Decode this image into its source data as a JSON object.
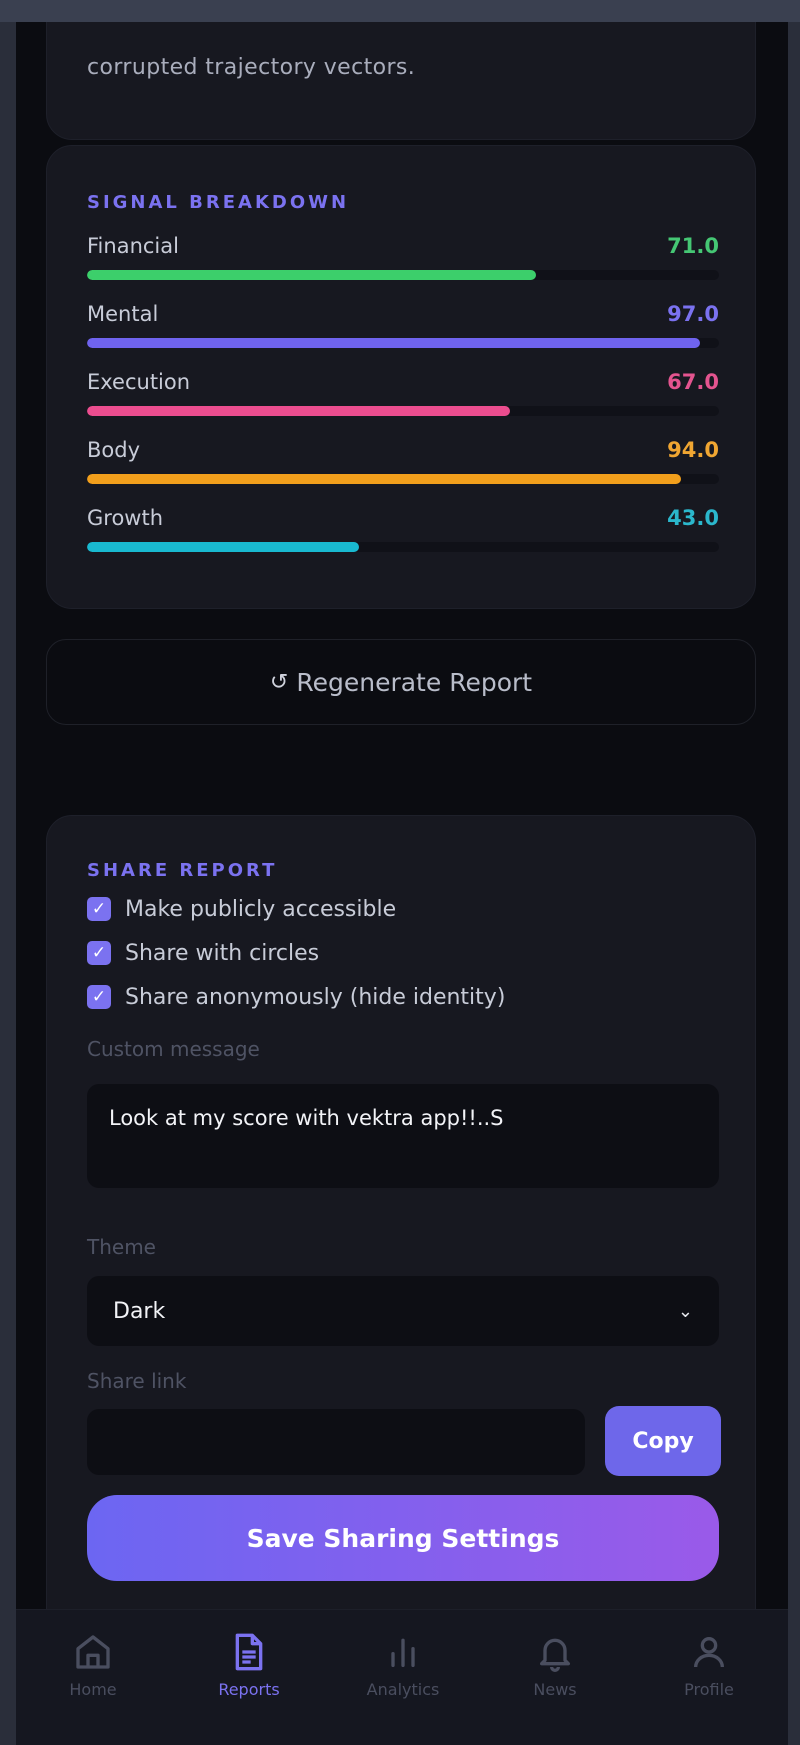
{
  "intro": {
    "text": "corrupted trajectory vectors."
  },
  "signal": {
    "title": "SIGNAL BREAKDOWN",
    "items": [
      {
        "label": "Financial",
        "value": "71.0",
        "fraction": 0.71,
        "color": "#3ccf6b",
        "value_color": "#45c774"
      },
      {
        "label": "Mental",
        "value": "97.0",
        "fraction": 0.97,
        "color": "#6f63ee",
        "value_color": "#7b72f0"
      },
      {
        "label": "Execution",
        "value": "67.0",
        "fraction": 0.67,
        "color": "#ec4d8f",
        "value_color": "#e4548f"
      },
      {
        "label": "Body",
        "value": "94.0",
        "fraction": 0.94,
        "color": "#f29f1c",
        "value_color": "#f0a632"
      },
      {
        "label": "Growth",
        "value": "43.0",
        "fraction": 0.43,
        "color": "#19b9d0",
        "value_color": "#2bb7cc"
      }
    ]
  },
  "regenerate": {
    "icon": "refresh-icon",
    "label": "Regenerate Report"
  },
  "share": {
    "title": "SHARE REPORT",
    "options": [
      {
        "label": "Make publicly accessible",
        "checked": true
      },
      {
        "label": "Share with circles",
        "checked": true
      },
      {
        "label": "Share anonymously (hide identity)",
        "checked": true
      }
    ],
    "custom_message_label": "Custom message",
    "custom_message_value": "Look at my score with vektra app!!..S",
    "theme_label": "Theme",
    "theme_value": "Dark",
    "share_link_label": "Share link",
    "share_link_value": "",
    "copy_label": "Copy",
    "save_label": "Save Sharing Settings"
  },
  "nav": {
    "items": [
      {
        "label": "Home",
        "icon": "home-icon",
        "active": false
      },
      {
        "label": "Reports",
        "icon": "document-icon",
        "active": true
      },
      {
        "label": "Analytics",
        "icon": "bar-chart-icon",
        "active": false
      },
      {
        "label": "News",
        "icon": "bell-icon",
        "active": false
      },
      {
        "label": "Profile",
        "icon": "user-icon",
        "active": false
      }
    ]
  },
  "colors": {
    "accent": "#7b72f0",
    "background": "#0b0c11",
    "card": "#171820"
  }
}
